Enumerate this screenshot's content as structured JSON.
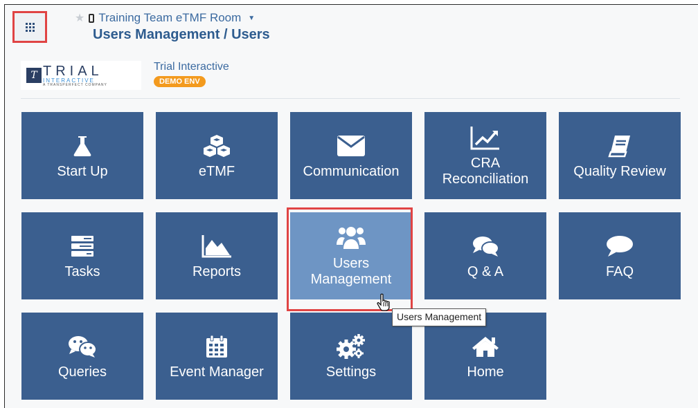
{
  "header": {
    "room_name": "Training Team eTMF Room",
    "page_title": "Users Management / Users",
    "apps_icon": "apps-grid-icon",
    "star_icon": "star-icon",
    "device_icon": "mobile-icon",
    "caret_icon": "caret-down-icon"
  },
  "logo": {
    "trial": "TRIAL",
    "interactive": "INTERACTIVE",
    "tagline": "A TRANSPERFECT COMPANY",
    "mark": "T"
  },
  "org": {
    "name": "Trial Interactive",
    "badge": "DEMO ENV"
  },
  "tiles": [
    {
      "label": "Start Up",
      "icon": "flask-icon"
    },
    {
      "label": "eTMF",
      "icon": "cubes-icon"
    },
    {
      "label": "Communication",
      "icon": "envelope-icon"
    },
    {
      "label": "CRA Reconciliation",
      "icon": "line-chart-icon"
    },
    {
      "label": "Quality Review",
      "icon": "book-icon"
    },
    {
      "label": "Tasks",
      "icon": "tasks-icon"
    },
    {
      "label": "Reports",
      "icon": "area-chart-icon"
    },
    {
      "label": "Users Management",
      "icon": "users-icon"
    },
    {
      "label": "Q & A",
      "icon": "comments-icon"
    },
    {
      "label": "FAQ",
      "icon": "comment-icon"
    },
    {
      "label": "Queries",
      "icon": "wechat-icon"
    },
    {
      "label": "Event Manager",
      "icon": "calendar-icon"
    },
    {
      "label": "Settings",
      "icon": "cogs-icon"
    },
    {
      "label": "Home",
      "icon": "home-icon"
    }
  ],
  "tooltip": "Users Management",
  "colors": {
    "tile": "#3b5f8f",
    "tile_hover": "#6e95c4",
    "highlight": "#e04444",
    "badge": "#f39a1e",
    "link": "#3b6aa0"
  }
}
